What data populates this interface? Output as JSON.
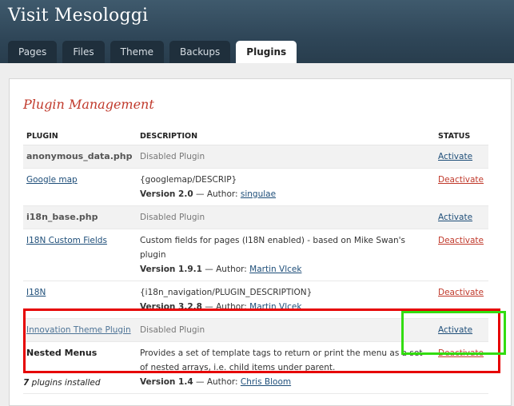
{
  "site": {
    "title": "Visit Mesologgi"
  },
  "tabs": [
    {
      "label": "Pages"
    },
    {
      "label": "Files"
    },
    {
      "label": "Theme"
    },
    {
      "label": "Backups"
    },
    {
      "label": "Plugins",
      "active": true
    }
  ],
  "page": {
    "title": "Plugin Management"
  },
  "table": {
    "headers": {
      "plugin": "PLUGIN",
      "description": "DESCRIPTION",
      "status": "STATUS"
    },
    "rows": [
      {
        "name": "anonymous_data.php",
        "desc": "Disabled Plugin",
        "status": "Activate",
        "disabled": true
      },
      {
        "name": "Google map",
        "desc": "{googlemap/DESCRIP}",
        "version": "Version 2.0",
        "sep": " — Author: ",
        "author": "singulae",
        "status": "Deactivate"
      },
      {
        "name": "i18n_base.php",
        "desc": "Disabled Plugin",
        "status": "Activate",
        "disabled": true
      },
      {
        "name": "I18N Custom Fields",
        "desc": "Custom fields for pages (I18N enabled) - based on Mike Swan's plugin",
        "version": "Version 1.9.1",
        "sep": " — Author: ",
        "author": "Martin Vlcek",
        "status": "Deactivate"
      },
      {
        "name": "I18N",
        "desc": "{i18n_navigation/PLUGIN_DESCRIPTION}",
        "version": "Version 3.2.8",
        "sep": " — Author: ",
        "author": "Martin Vlcek",
        "status": "Deactivate"
      },
      {
        "name": "Innovation Theme Plugin",
        "desc": "Disabled Plugin",
        "status": "Activate",
        "disabled": true
      },
      {
        "name": "Nested Menus",
        "desc": "Provides a set of template tags to return or print the menu as a set of nested arrays, i.e. child items under parent.",
        "version": "Version 1.4",
        "sep": " — Author: ",
        "author": "Chris Bloom",
        "status": "Deactivate"
      }
    ]
  },
  "footer": {
    "count": "7",
    "text": " plugins installed"
  },
  "colors": {
    "header": "#2f4658",
    "accent": "#c0392b",
    "link": "#1e4e79",
    "highlight_red": "#e60000",
    "highlight_green": "#33dd11"
  }
}
